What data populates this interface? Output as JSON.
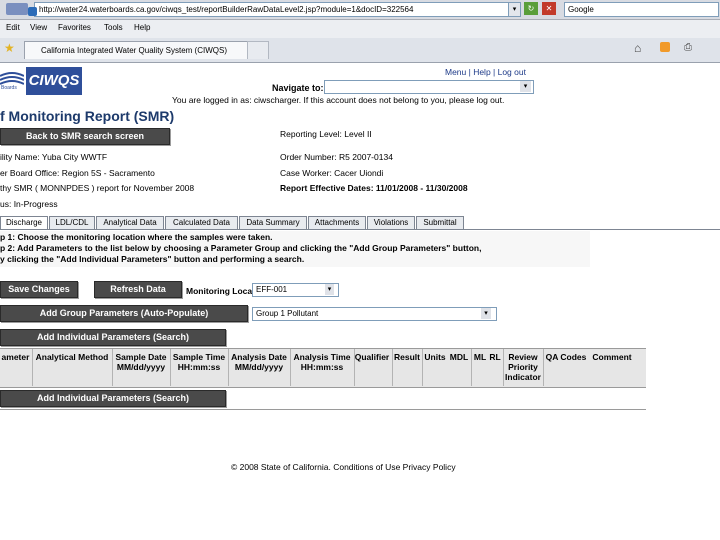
{
  "browser": {
    "url": "http://water24.waterboards.ca.gov/ciwqs_test/reportBuilderRawDataLevel2.jsp?module=1&docID=322564",
    "search": "Google",
    "menu": [
      "Edit",
      "View",
      "Favorites",
      "Tools",
      "Help"
    ],
    "tab_title": "California Integrated Water Quality System (CIWQS)"
  },
  "header": {
    "logo_text": "CIWQS",
    "logo_sub": "Boards",
    "links": "Menu | Help | Log out",
    "navigate_label": "Navigate to:",
    "logged_msg": "You are logged in as: ciwscharger. If this account does not belong to you, please log out."
  },
  "page": {
    "title": "f Monitoring Report (SMR)",
    "back_button": "Back to SMR search screen",
    "reporting_level": "Reporting Level: Level II",
    "facility": "ility Name: Yuba City WWTF",
    "order_number": "Order Number: R5 2007-0134",
    "board_office": "er Board Office: Region 5S - Sacramento",
    "case_worker": "Case Worker: Cacer Uiondi",
    "report": "thy SMR ( MONNPDES ) report for November 2008",
    "effective_dates": "Report Effective Dates: 11/01/2008 - 11/30/2008",
    "status": "us: In-Progress"
  },
  "tabs": [
    "Discharge",
    "LDL/CDL",
    "Analytical Data",
    "Calculated Data",
    "Data Summary",
    "Attachments",
    "Violations",
    "Submittal"
  ],
  "steps": {
    "step1": "p 1: Choose the monitoring location where the samples were taken.",
    "step2": "p 2: Add Parameters to the list below by choosing a Parameter Group and clicking the \"Add Group Parameters\" button,",
    "step3": "y clicking the \"Add Individual Parameters\" button and performing a search."
  },
  "controls": {
    "save_label": "Save Changes",
    "refresh_label": "Refresh Data",
    "monitoring_location_label": "Monitoring Location:",
    "monitoring_location_value": "EFF-001",
    "add_group_label": "Add Group Parameters (Auto-Populate)",
    "group_value": "Group 1 Pollutant",
    "add_individual_label": "Add Individual Parameters (Search)",
    "add_individual_label_bottom": "Add Individual Parameters (Search)"
  },
  "table": {
    "headers": [
      "ameter",
      "Analytical Method",
      "Sample Date MM/dd/yyyy",
      "Sample Time HH:mm:ss",
      "Analysis Date MM/dd/yyyy",
      "Analysis Time HH:mm:ss",
      "Qualifier",
      "Result",
      "Units",
      "MDL",
      "ML",
      "RL",
      "Review Priority Indicator",
      "QA Codes",
      "Comment"
    ]
  },
  "footer": {
    "copyright": "© 2008 State of California.",
    "conditions": "Conditions of Use",
    "privacy": "Privacy Policy"
  }
}
